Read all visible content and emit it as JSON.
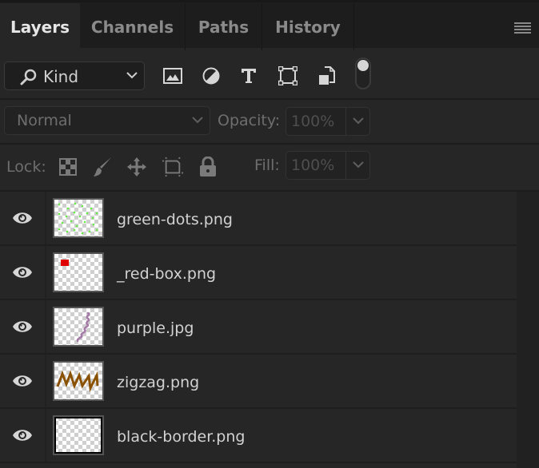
{
  "tabs": [
    {
      "label": "Layers",
      "active": true
    },
    {
      "label": "Channels",
      "active": false
    },
    {
      "label": "Paths",
      "active": false
    },
    {
      "label": "History",
      "active": false
    }
  ],
  "filter": {
    "kind_label": "Kind",
    "icons": [
      "image-filter-icon",
      "adjustment-filter-icon",
      "type-filter-icon",
      "shape-filter-icon",
      "smart-object-filter-icon"
    ],
    "filter_toggle_on": true
  },
  "blend": {
    "mode": "Normal",
    "opacity_label": "Opacity:",
    "opacity_value": "100%"
  },
  "lock": {
    "label": "Lock:",
    "fill_label": "Fill:",
    "fill_value": "100%"
  },
  "layers": [
    {
      "name": "green-dots.png",
      "visible": true,
      "thumb": "green-dots",
      "color": "#66ee44"
    },
    {
      "name": "_red-box.png",
      "visible": true,
      "thumb": "red-box",
      "color": "#e00000"
    },
    {
      "name": "purple.jpg",
      "visible": true,
      "thumb": "purple-squiggle",
      "color": "#a57aa8"
    },
    {
      "name": "zigzag.png",
      "visible": true,
      "thumb": "zigzag",
      "color": "#8a5200"
    },
    {
      "name": "black-border.png",
      "visible": true,
      "thumb": "black-border",
      "color": "#000000"
    }
  ]
}
